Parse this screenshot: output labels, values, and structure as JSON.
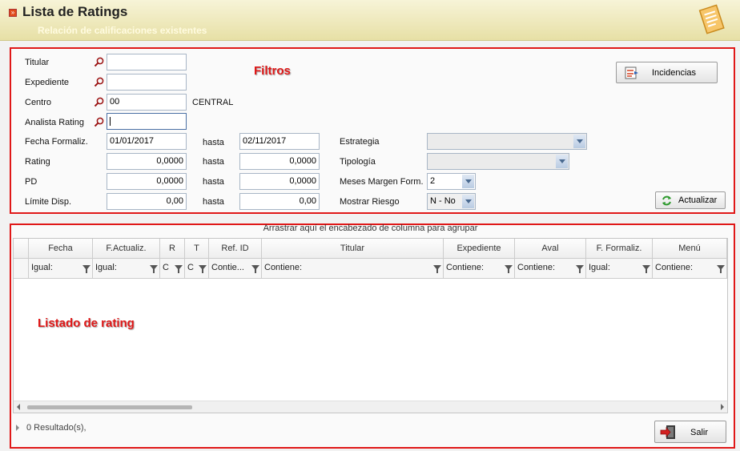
{
  "header": {
    "title": "Lista de Ratings",
    "subtitle": "Relación de calificaciones existentes"
  },
  "annotations": {
    "filters": "Filtros",
    "listing": "Listado de rating"
  },
  "filters": {
    "titular": {
      "label": "Titular",
      "value": ""
    },
    "expediente": {
      "label": "Expediente",
      "value": ""
    },
    "centro": {
      "label": "Centro",
      "value": "00",
      "desc": "CENTRAL"
    },
    "analista": {
      "label": "Analista Rating",
      "value": ""
    },
    "fecha_formaliz": {
      "label": "Fecha Formaliz.",
      "from": "01/01/2017",
      "hasta": "hasta",
      "to": "02/11/2017"
    },
    "rating": {
      "label": "Rating",
      "from": "0,0000",
      "hasta": "hasta",
      "to": "0,0000"
    },
    "pd": {
      "label": "PD",
      "from": "0,0000",
      "hasta": "hasta",
      "to": "0,0000"
    },
    "limite": {
      "label": "Límite Disp.",
      "from": "0,00",
      "hasta": "hasta",
      "to": "0,00"
    },
    "estrategia": {
      "label": "Estrategia",
      "value": ""
    },
    "tipologia": {
      "label": "Tipología",
      "value": ""
    },
    "meses": {
      "label": "Meses Margen Form.",
      "value": "2"
    },
    "riesgo": {
      "label": "Mostrar Riesgo",
      "value": "N - No"
    }
  },
  "buttons": {
    "incidencias": "Incidencias",
    "actualizar": "Actualizar",
    "salir": "Salir"
  },
  "grid": {
    "group_hint": "Arrastrar aquí el encabezado de columna para agrupar",
    "columns": [
      {
        "header": "Fecha",
        "filter": "Igual:"
      },
      {
        "header": "F.Actualiz.",
        "filter": "Igual:"
      },
      {
        "header": "R",
        "filter": "C"
      },
      {
        "header": "T",
        "filter": "C"
      },
      {
        "header": "Ref. ID",
        "filter": "Contie..."
      },
      {
        "header": "Titular",
        "filter": "Contiene:"
      },
      {
        "header": "Expediente",
        "filter": "Contiene:"
      },
      {
        "header": "Aval",
        "filter": "Contiene:"
      },
      {
        "header": "F. Formaliz.",
        "filter": "Igual:"
      },
      {
        "header": "Menú",
        "filter": "Contiene:"
      }
    ],
    "footer": "0 Resultado(s),"
  },
  "colors": {
    "annotation": "#e01818",
    "header_bg": "#ebe4b0",
    "subtitle": "#fffbe0"
  },
  "icons": [
    "search-icon",
    "document-icon",
    "incidents-icon",
    "refresh-icon",
    "exit-icon",
    "filter-icon"
  ]
}
